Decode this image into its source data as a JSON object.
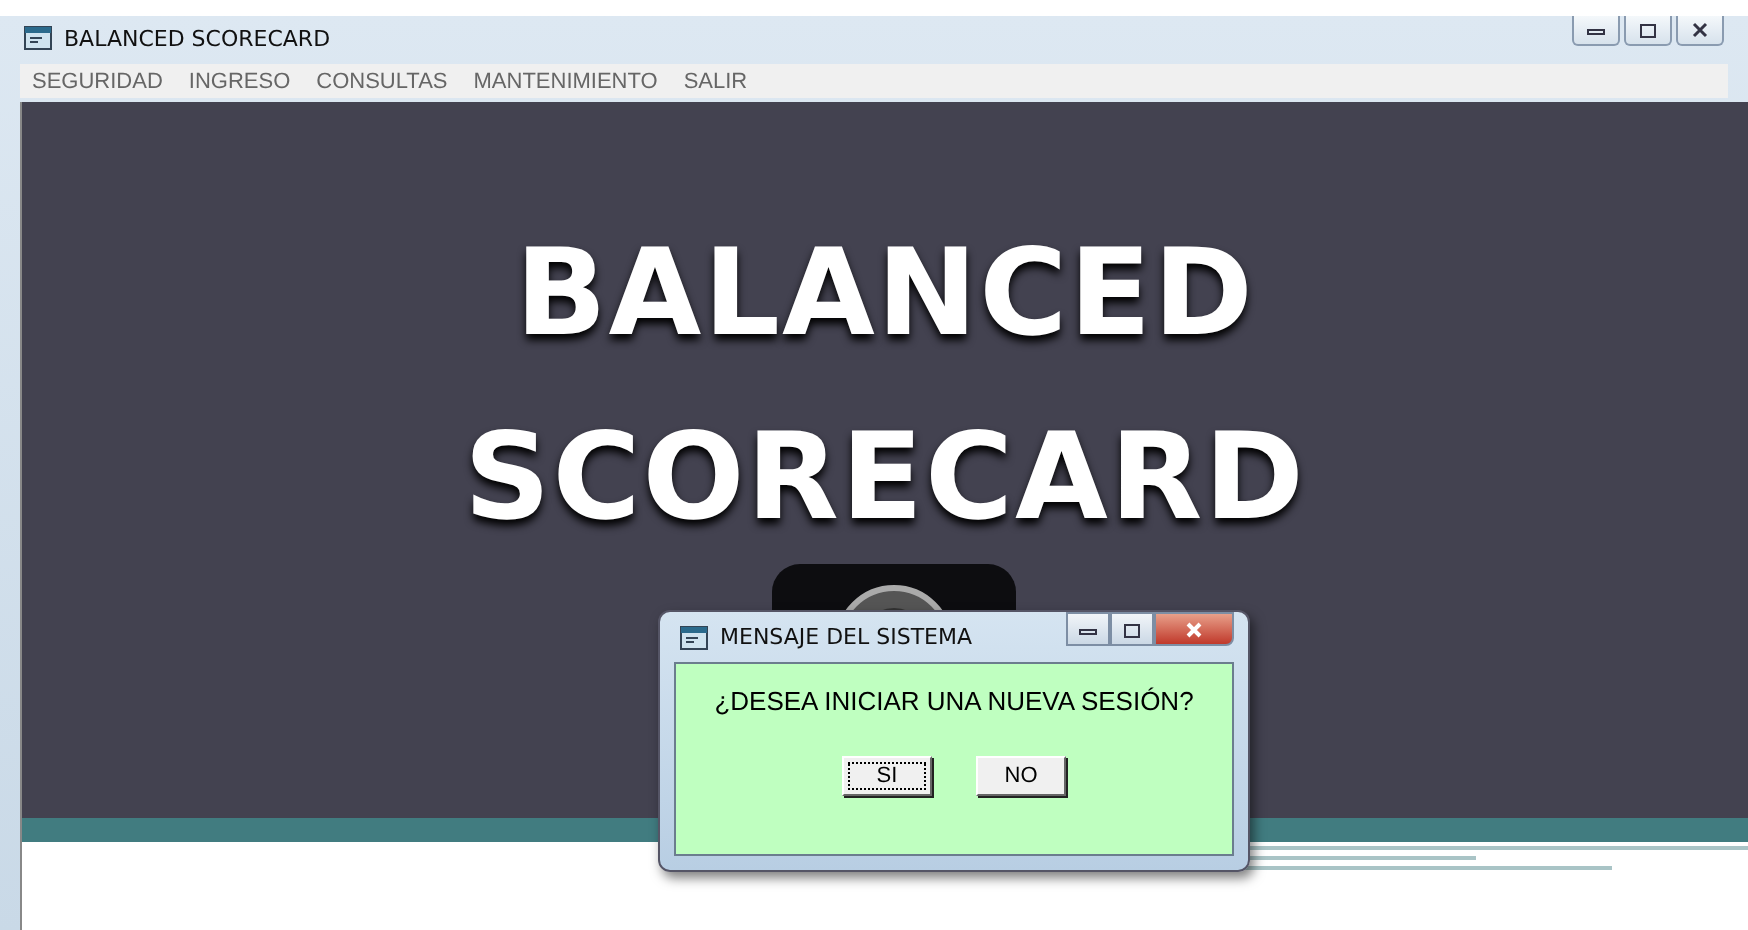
{
  "window": {
    "title": "BALANCED SCORECARD"
  },
  "menu": [
    {
      "label": "SEGURIDAD"
    },
    {
      "label": "INGRESO"
    },
    {
      "label": "CONSULTAS"
    },
    {
      "label": "MANTENIMIENTO"
    },
    {
      "label": "SALIR"
    }
  ],
  "banner": {
    "lines": [
      "BALANCED",
      "SCORECARD"
    ]
  },
  "dialog": {
    "title": "MENSAJE DEL SISTEMA",
    "message": "¿DESEA INICIAR UNA NUEVA SESIÓN?",
    "buttons": [
      {
        "label": "SI",
        "selected": true
      },
      {
        "label": "NO",
        "selected": false
      }
    ]
  }
}
